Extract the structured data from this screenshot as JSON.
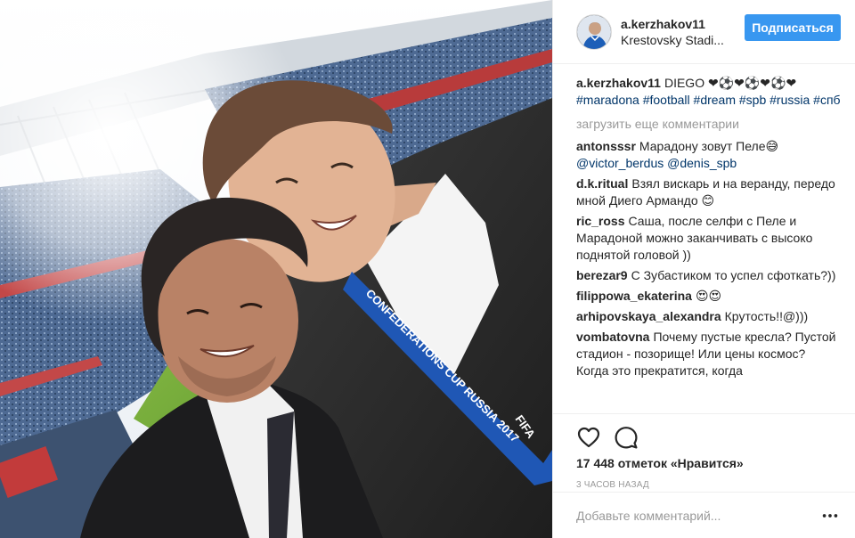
{
  "header": {
    "username": "a.kerzhakov11",
    "location": "Krestovsky Stadi...",
    "follow_label": "Подписаться"
  },
  "caption": {
    "username": "a.kerzhakov11",
    "text": "DIEGO ❤⚽❤⚽❤⚽❤",
    "hashtags": "#maradona #football #dream #spb #russia #спб"
  },
  "load_more_label": "загрузить еще комментарии",
  "comments": [
    {
      "username": "antonsssr",
      "text": "Марадону зовут Пеле😅",
      "mentions": "@victor_berdus @denis_spb"
    },
    {
      "username": "d.k.ritual",
      "text": "Взял вискарь и на веранду, передо мной Диего Армандо 😊"
    },
    {
      "username": "ric_ross",
      "text": "Саша, после селфи с Пеле и Марадоной можно заканчивать с высоко поднятой головой ))"
    },
    {
      "username": "berezar9",
      "text": "С Зубастиком то успел сфоткать?))"
    },
    {
      "username": "filippowa_ekaterina",
      "text": "😍😍"
    },
    {
      "username": "arhipovskaya_alexandra",
      "text": "Крутость!!@)))"
    },
    {
      "username": "vombatovna",
      "text": "Почему пустые кресла? Пустой стадион - позорище! Или цены космос? Когда это прекратится, когда"
    }
  ],
  "likes_text": "17 448 отметок «Нравится»",
  "time_text": "3 часов назад",
  "add_comment_placeholder": "Добавьте комментарий...",
  "photo": {
    "lanyard_text": "CONFEDERATIONS CUP RUSSIA 2017",
    "fifa_text": "FIFA"
  },
  "icons": {
    "like": "heart-icon",
    "comment": "speech-bubble-icon",
    "options": "more-dots-icon"
  },
  "colors": {
    "follow_button": "#3897f0",
    "hashtag": "#003569",
    "muted": "#999999"
  }
}
